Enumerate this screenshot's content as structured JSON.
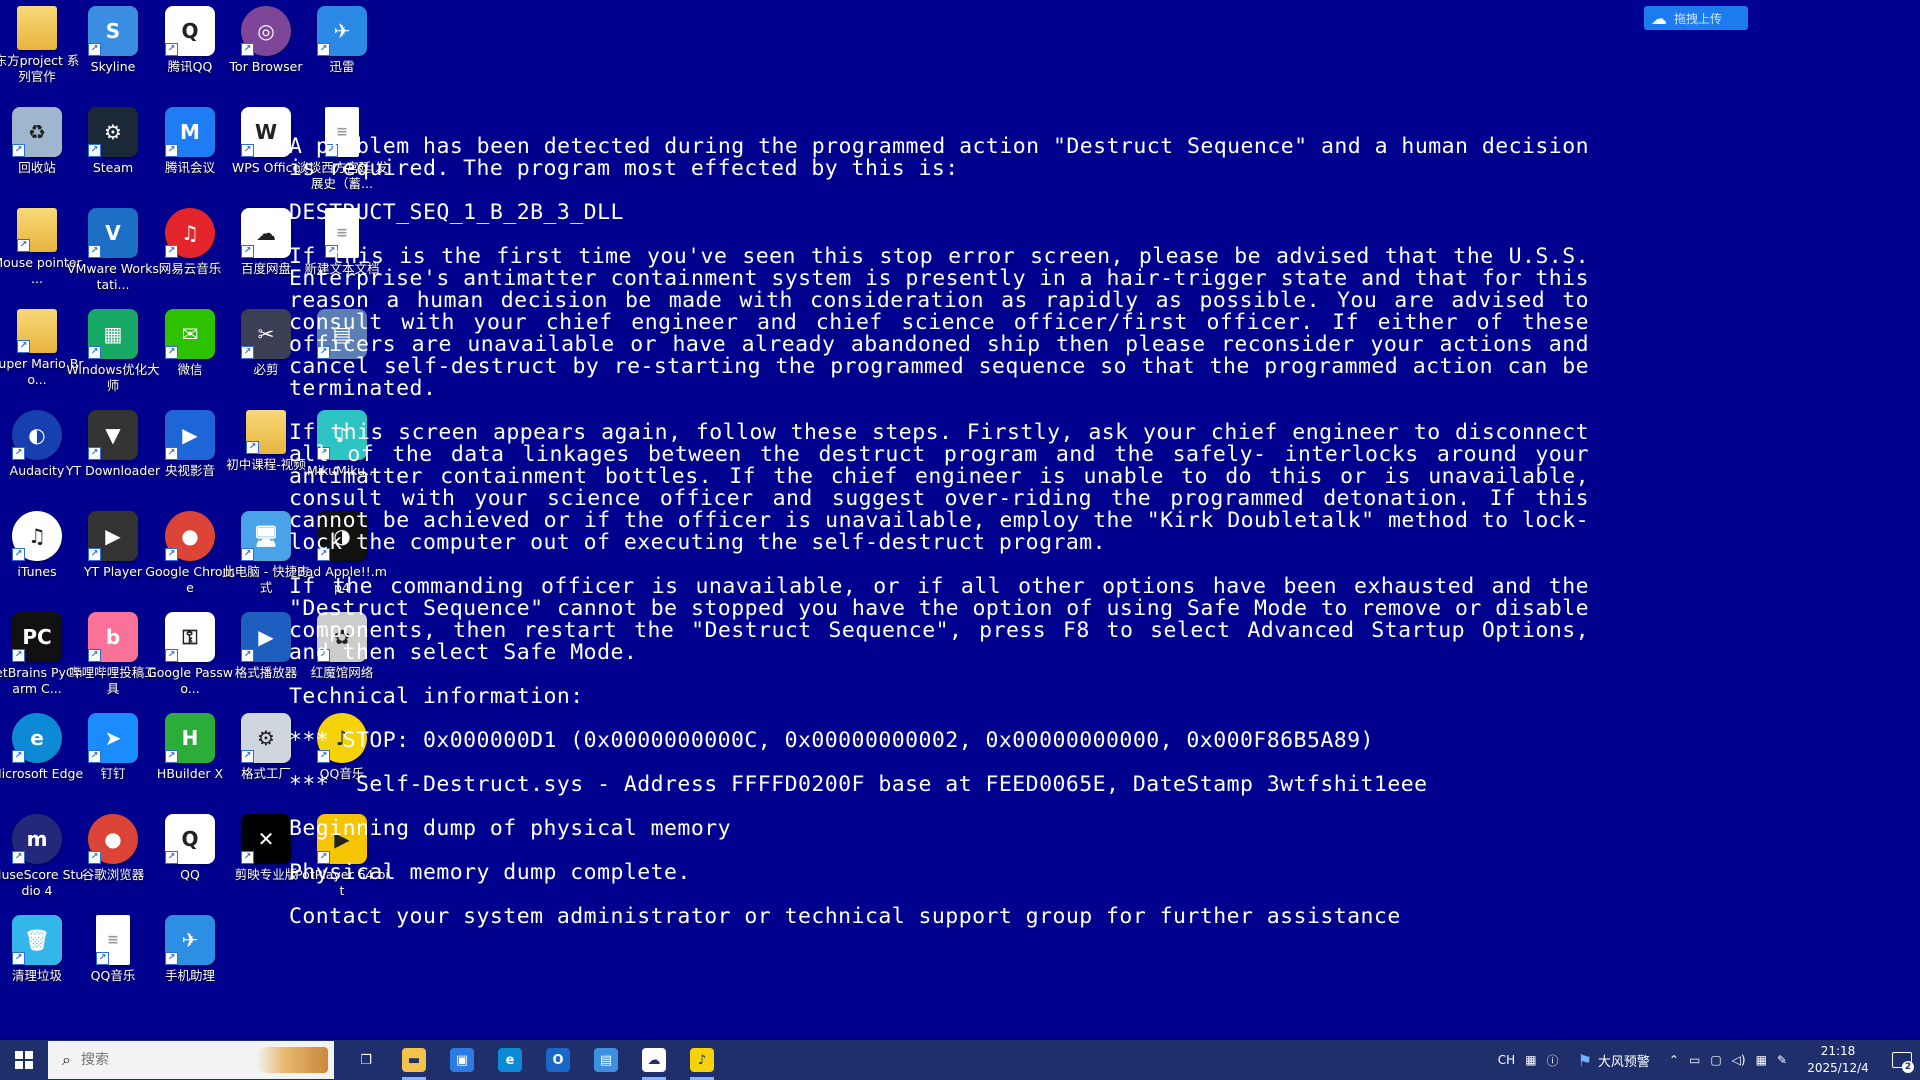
{
  "desktop": {
    "icons": [
      {
        "label": "东方project 系列官作",
        "icon": "folder-icon",
        "bg": "",
        "glyph": ""
      },
      {
        "label": "Skyline",
        "icon": "skyline-icon",
        "bg": "#3a8de0",
        "glyph": "S"
      },
      {
        "label": "腾讯QQ",
        "icon": "qq-penguin-icon",
        "bg": "#ffffff",
        "glyph": "Q"
      },
      {
        "label": "Tor Browser",
        "icon": "tor-browser-icon",
        "bg": "#7d4698",
        "glyph": "◎"
      },
      {
        "label": "迅雷",
        "icon": "xunlei-icon",
        "bg": "#2b8ae6",
        "glyph": "✈"
      },
      {
        "label": "回收站",
        "icon": "recycle-bin-icon",
        "bg": "#9fb6cf",
        "glyph": "♻"
      },
      {
        "label": "Steam",
        "icon": "steam-icon",
        "bg": "#1b2838",
        "glyph": "⚙"
      },
      {
        "label": "腾讯会议",
        "icon": "tencent-meeting-icon",
        "bg": "#1e7df2",
        "glyph": "M"
      },
      {
        "label": "WPS Office",
        "icon": "wps-office-icon",
        "bg": "#ffffff",
        "glyph": "W"
      },
      {
        "label": "谈谈西方宫廷 发展史（蓄...",
        "icon": "text-document-icon",
        "bg": "",
        "glyph": ""
      },
      {
        "label": "Mouse pointer ...",
        "icon": "folder-icon",
        "bg": "",
        "glyph": ""
      },
      {
        "label": "VMware Workstati...",
        "icon": "vmware-icon",
        "bg": "#1d6fc5",
        "glyph": "V"
      },
      {
        "label": "网易云音乐",
        "icon": "netease-music-icon",
        "bg": "#e3262b",
        "glyph": "♫"
      },
      {
        "label": "百度网盘",
        "icon": "baidu-netdisk-icon",
        "bg": "#ffffff",
        "glyph": "☁"
      },
      {
        "label": "新建文本文档",
        "icon": "text-document-icon",
        "bg": "",
        "glyph": ""
      },
      {
        "label": "Super Mario Bro...",
        "icon": "folder-icon",
        "bg": "",
        "glyph": ""
      },
      {
        "label": "Windows优化大师",
        "icon": "windows-optimizer-icon",
        "bg": "#18a866",
        "glyph": "▦"
      },
      {
        "label": "微信",
        "icon": "wechat-icon",
        "bg": "#2dc100",
        "glyph": "✉"
      },
      {
        "label": "必剪",
        "icon": "bijian-icon",
        "bg": "#3b3f55",
        "glyph": "✂"
      },
      {
        "label": "",
        "icon": "installer-icon",
        "bg": "#5b7fb5",
        "glyph": "▤"
      },
      {
        "label": "Audacity",
        "icon": "audacity-icon",
        "bg": "#1640b0",
        "glyph": "◐"
      },
      {
        "label": "YT Downloader",
        "icon": "yt-downloader-icon",
        "bg": "#333333",
        "glyph": "▼"
      },
      {
        "label": "央视影音",
        "icon": "cctv-video-icon",
        "bg": "#1e66d8",
        "glyph": "▶"
      },
      {
        "label": "初中课程-视频",
        "icon": "folder-icon",
        "bg": "",
        "glyph": ""
      },
      {
        "label": "MikuMiku...",
        "icon": "miku-icon",
        "bg": "#2ec4c4",
        "glyph": "♪"
      },
      {
        "label": "iTunes",
        "icon": "itunes-icon",
        "bg": "#ffffff",
        "glyph": "♫"
      },
      {
        "label": "YT Player",
        "icon": "yt-player-icon",
        "bg": "#333333",
        "glyph": "▶"
      },
      {
        "label": "Google Chrome",
        "icon": "chrome-icon",
        "bg": "#db4437",
        "glyph": "●"
      },
      {
        "label": "此电脑 - 快捷方式",
        "icon": "this-pc-icon",
        "bg": "#4aa3e6",
        "glyph": "🖥"
      },
      {
        "label": "Bad Apple!!.mp4",
        "icon": "video-file-icon",
        "bg": "#111111",
        "glyph": "◑"
      },
      {
        "label": "JetBrains PyCharm C...",
        "icon": "pycharm-icon",
        "bg": "#111111",
        "glyph": "PC"
      },
      {
        "label": "哔哩哔哩投稿工具",
        "icon": "bilibili-upload-icon",
        "bg": "#fb7299",
        "glyph": "b"
      },
      {
        "label": "Google Passwo...",
        "icon": "google-password-icon",
        "bg": "#ffffff",
        "glyph": "⚿"
      },
      {
        "label": "格式播放器",
        "icon": "format-player-icon",
        "bg": "#1c5fbf",
        "glyph": "▶"
      },
      {
        "label": "红魔馆网络",
        "icon": "touhou-icon",
        "bg": "#cccccc",
        "glyph": "✿"
      },
      {
        "label": "Microsoft Edge",
        "icon": "edge-icon",
        "bg": "#0c8ad6",
        "glyph": "e"
      },
      {
        "label": "钉钉",
        "icon": "dingtalk-icon",
        "bg": "#1a8cff",
        "glyph": "➤"
      },
      {
        "label": "HBuilder X",
        "icon": "hbuilder-icon",
        "bg": "#2cad3a",
        "glyph": "H"
      },
      {
        "label": "格式工厂",
        "icon": "format-factory-icon",
        "bg": "#cfd6de",
        "glyph": "⚙"
      },
      {
        "label": "QQ音乐",
        "icon": "qq-music-icon",
        "bg": "#f5d20a",
        "glyph": "♪"
      },
      {
        "label": "MuseScore Studio 4",
        "icon": "musescore-icon",
        "bg": "#24287a",
        "glyph": "m"
      },
      {
        "label": "谷歌浏览器",
        "icon": "chrome-icon",
        "bg": "#db4437",
        "glyph": "●"
      },
      {
        "label": "QQ",
        "icon": "qq-penguin-icon",
        "bg": "#ffffff",
        "glyph": "Q"
      },
      {
        "label": "剪映专业版",
        "icon": "capcut-icon",
        "bg": "#000000",
        "glyph": "✕"
      },
      {
        "label": "PotPlayer 64 bit",
        "icon": "potplayer-icon",
        "bg": "#f6c400",
        "glyph": "▶"
      },
      {
        "label": "清理垃圾",
        "icon": "clean-trash-icon",
        "bg": "#35b6e8",
        "glyph": "🗑"
      },
      {
        "label": "QQ音乐",
        "icon": "text-document-icon",
        "bg": "",
        "glyph": ""
      },
      {
        "label": "手机助理",
        "icon": "phone-assistant-icon",
        "bg": "#2d8fe3",
        "glyph": "✈"
      }
    ]
  },
  "upload_pill": {
    "label": "拖拽上传",
    "icon": "baidu-cloud-icon"
  },
  "bsod": {
    "paragraphs": [
      "A problem has been detected during the programmed action \"Destruct Sequence\" and a human decision is required. The program most effected by this is:",
      "DESTRUCT_SEQ_1_B_2B_3_DLL",
      "If this is the first time you've seen this stop error screen, please be advised that the U.S.S. Enterprise's antimatter containment system is presently in a hair-trigger state and that for this reason a human decision be made with consideration as rapidly as possible. You are advised to consult with your chief engineer and chief science officer/first officer. If either of these officers are unavailable or have already abandoned ship then please reconsider your actions and cancel self-destruct by re-starting the programmed sequence so that the programmed action can be terminated.",
      "If this screen appears again, follow these steps. Firstly, ask your chief engineer to disconnect all of the data linkages between the destruct program and the safely- interlocks around your antimatter containment bottles. If the chief engineer is unable to do this or is unavailable, consult with your science officer and suggest over-riding the programmed detonation. If this cannot be achieved or if the officer is unavailable, employ the \"Kirk Doubletalk\" method to lock-lock the computer out of executing the self-destruct program.",
      "If the commanding officer is unavailable, or if all other options have been exhausted and the \"Destruct Sequence\" cannot be stopped you have the option of using Safe Mode to remove or disable components, then restart the \"Destruct Sequence\", press F8 to select Advanced Startup Options, and then select Safe Mode.",
      "Technical information:",
      "*** STOP: 0x000000D1 (0x0000000000C, 0x00000000002, 0x00000000000, 0x000F86B5A89)",
      "***  Self-Destruct.sys - Address FFFFD0200F base at FEED0065E, DateStamp 3wtfshit1eee",
      "Beginning dump of physical memory",
      "Physical memory dump complete.",
      "Contact your system administrator or technical support group for further assistance"
    ]
  },
  "taskbar": {
    "start_icon": "windows-start-icon",
    "search_placeholder": "搜索",
    "apps": [
      {
        "name": "task-view",
        "icon": "task-view-icon",
        "bg": "transparent",
        "glyph": "❐",
        "active": false
      },
      {
        "name": "file-explorer",
        "icon": "file-explorer-icon",
        "bg": "#f2c14e",
        "glyph": "▬",
        "active": true
      },
      {
        "name": "microsoft-store",
        "icon": "store-icon",
        "bg": "#2d7be5",
        "glyph": "▣",
        "active": false
      },
      {
        "name": "edge",
        "icon": "edge-icon",
        "bg": "#0c8ad6",
        "glyph": "e",
        "active": false
      },
      {
        "name": "outlook",
        "icon": "outlook-icon",
        "bg": "#1a66c9",
        "glyph": "O",
        "active": false
      },
      {
        "name": "control-panel",
        "icon": "control-panel-icon",
        "bg": "#3d8fdf",
        "glyph": "▤",
        "active": false
      },
      {
        "name": "baidu-netdisk",
        "icon": "baidu-netdisk-icon",
        "bg": "#ffffff",
        "glyph": "☁",
        "active": true
      },
      {
        "name": "qq-music",
        "icon": "qq-music-icon",
        "bg": "#f5d20a",
        "glyph": "♪",
        "active": true
      }
    ],
    "tray": {
      "ime": "CH",
      "weather": "大风预警",
      "time": "21:18",
      "date": "2025/12/4",
      "notifications": "2"
    }
  }
}
